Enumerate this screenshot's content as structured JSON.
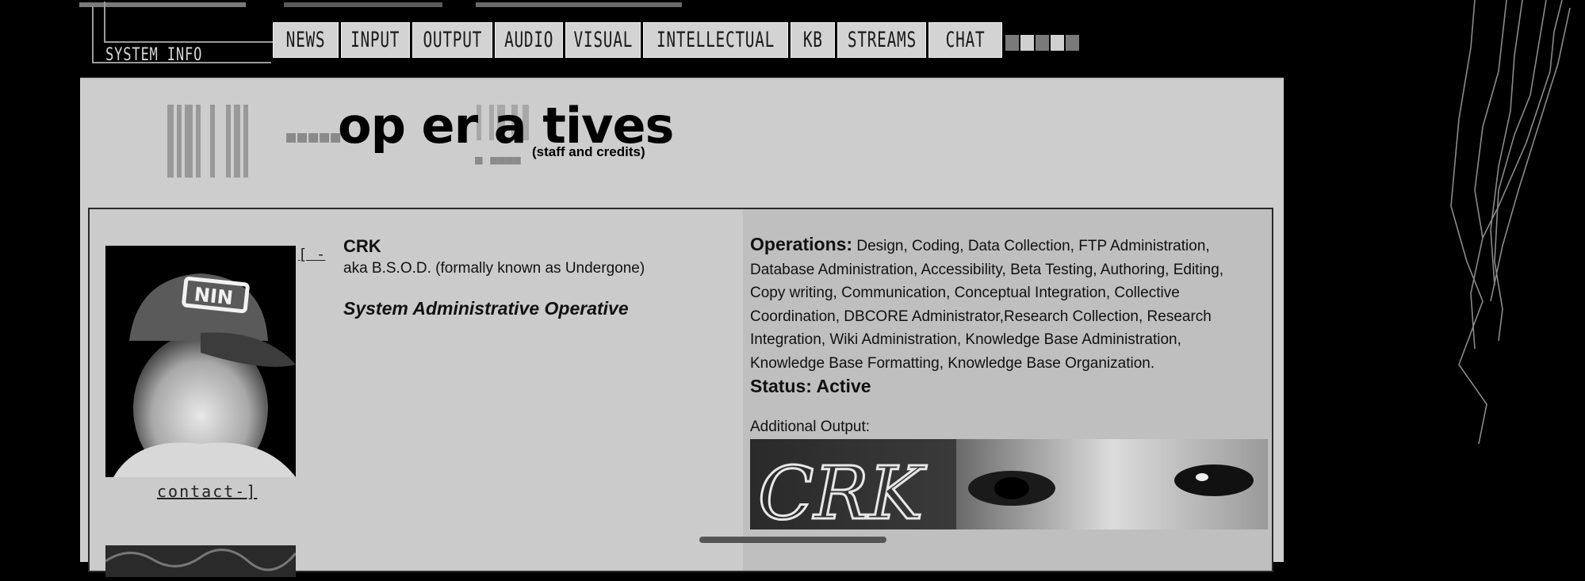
{
  "header": {
    "system_info": "SYSTEM INFO",
    "nav": [
      "NEWS",
      "INPUT",
      "OUTPUT",
      "AUDIO",
      "VISUAL",
      "INTELLECTUAL",
      "KB",
      "STREAMS",
      "CHAT"
    ]
  },
  "logo": {
    "title": "op er a tives",
    "subtitle": "(staff and credits)"
  },
  "profile": {
    "bracket_link": "[ -",
    "contact_link": "contact-]",
    "name": "CRK",
    "aka": "aka B.S.O.D. (formally known as Undergone)",
    "role": "System Administrative Operative",
    "operations_label": "Operations:",
    "operations_text": "Design, Coding, Data Collection, FTP Administration, Database Administration, Accessibility, Beta Testing, Authoring, Editing, Copy writing, Communication, Conceptual Integration, Collective Coordination, DBCORE Administrator,Research Collection, Research Integration, Wiki Administration, Knowledge Base Administration, Knowledge Base Formatting, Knowledge Base Organization.",
    "status": "Status: Active",
    "additional_output": "Additional Output:",
    "banner_text": "CRK"
  },
  "colors": {
    "background": "#000000",
    "panel": "#cdcdcd",
    "operations_column": "#bfbfbf",
    "nav_button": "#d3d3d3"
  }
}
